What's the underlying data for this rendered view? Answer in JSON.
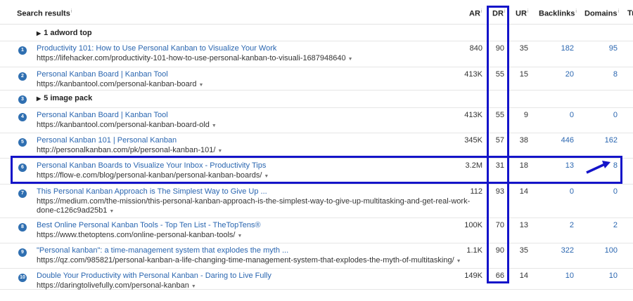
{
  "header": {
    "search_results": "Search results",
    "ar": "AR",
    "dr": "DR",
    "ur": "UR",
    "backlinks": "Backlinks",
    "domains": "Domains",
    "tr": "Tr"
  },
  "rows": [
    {
      "type": "group",
      "num": "",
      "label": "1 adword top"
    },
    {
      "type": "result",
      "num": "1",
      "title": "Productivity 101: How to Use Personal Kanban to Visualize Your Work",
      "url": "https://lifehacker.com/productivity-101-how-to-use-personal-kanban-to-visuali-1687948640",
      "url2": "",
      "ar": "840",
      "dr": "90",
      "ur": "35",
      "backlinks": "182",
      "domains": "95"
    },
    {
      "type": "result",
      "num": "2",
      "title": "Personal Kanban Board | Kanban Tool",
      "url": "https://kanbantool.com/personal-kanban-board",
      "url2": "",
      "ar": "413K",
      "dr": "55",
      "ur": "15",
      "backlinks": "20",
      "domains": "8"
    },
    {
      "type": "group",
      "num": "3",
      "label": "5 image pack"
    },
    {
      "type": "result",
      "num": "4",
      "title": "Personal Kanban Board | Kanban Tool",
      "url": "https://kanbantool.com/personal-kanban-board-old",
      "url2": "",
      "ar": "413K",
      "dr": "55",
      "ur": "9",
      "backlinks": "0",
      "domains": "0"
    },
    {
      "type": "result",
      "num": "5",
      "title": "Personal Kanban 101 | Personal Kanban",
      "url": "http://personalkanban.com/pk/personal-kanban-101/",
      "url2": "",
      "ar": "345K",
      "dr": "57",
      "ur": "38",
      "backlinks": "446",
      "domains": "162"
    },
    {
      "type": "result",
      "num": "6",
      "title": "Personal Kanban Boards to Visualize Your Inbox - Productivity Tips",
      "url": "https://flow-e.com/blog/personal-kanban/personal-kanban-boards/",
      "url2": "",
      "ar": "3.2M",
      "dr": "31",
      "ur": "18",
      "backlinks": "13",
      "domains": "8"
    },
    {
      "type": "result",
      "num": "7",
      "title": "This Personal Kanban Approach is The Simplest Way to Give Up ...",
      "url": "https://medium.com/the-mission/this-personal-kanban-approach-is-the-simplest-way-to-give-up-multitasking-and-get-real-work-",
      "url2": "done-c126c9ad25b1",
      "ar": "112",
      "dr": "93",
      "ur": "14",
      "backlinks": "0",
      "domains": "0"
    },
    {
      "type": "result",
      "num": "8",
      "title": "Best Online Personal Kanban Tools - Top Ten List - TheTopTens®",
      "url": "https://www.thetoptens.com/online-personal-kanban-tools/",
      "url2": "",
      "ar": "100K",
      "dr": "70",
      "ur": "13",
      "backlinks": "2",
      "domains": "2"
    },
    {
      "type": "result",
      "num": "9",
      "title": "\"Personal kanban\": a time-management system that explodes the myth ...",
      "url": "https://qz.com/985821/personal-kanban-a-life-changing-time-management-system-that-explodes-the-myth-of-multitasking/",
      "url2": "",
      "ar": "1.1K",
      "dr": "90",
      "ur": "35",
      "backlinks": "322",
      "domains": "100"
    },
    {
      "type": "result",
      "num": "10",
      "title": "Double Your Productivity with Personal Kanban - Daring to Live Fully",
      "url": "https://daringtolivefully.com/personal-kanban",
      "url2": "",
      "ar": "149K",
      "dr": "66",
      "ur": "14",
      "backlinks": "10",
      "domains": "10"
    }
  ],
  "colors": {
    "link": "#2a66b0",
    "badge": "#2f6fb1",
    "annotation": "#1414c9"
  },
  "icons": {
    "info": "info-icon",
    "caret": "caret-down-icon",
    "expand": "triangle-right-icon",
    "arrow": "annotation-arrow-icon"
  }
}
